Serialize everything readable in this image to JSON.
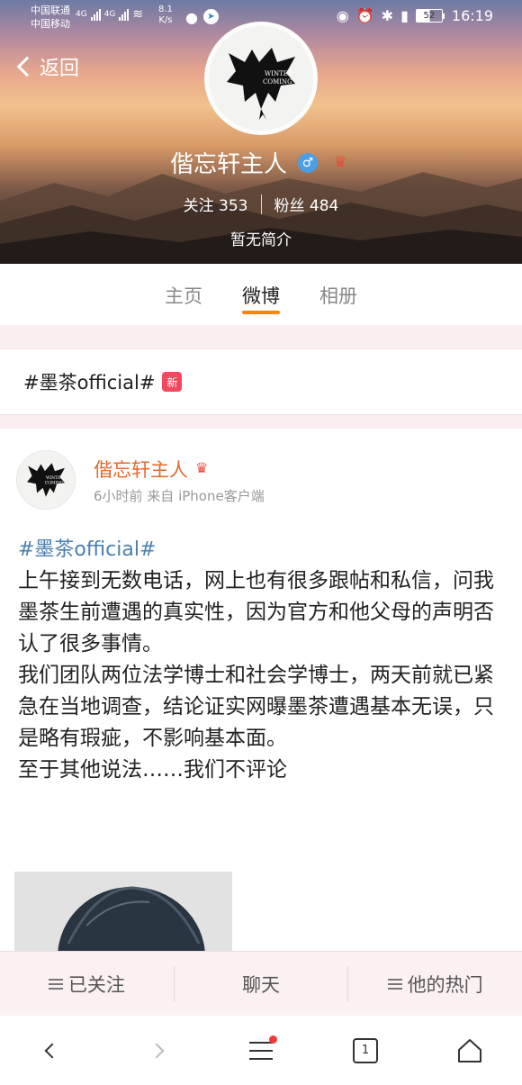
{
  "status_bar": {
    "carrier1": "中国联通",
    "carrier2": "中国移动",
    "net1": "4G",
    "net2": "4G",
    "speed_value": "8.1",
    "speed_unit": "K/s",
    "battery": "52",
    "time": "16:19"
  },
  "header": {
    "back_label": "返回",
    "name": "偕忘轩主人",
    "gender_symbol": "♂",
    "following_label": "关注",
    "following_count": "353",
    "followers_label": "粉丝",
    "followers_count": "484",
    "bio": "暂无简介",
    "avatar_text_1": "WINTER",
    "avatar_text_2": "COMING"
  },
  "tabs": [
    {
      "label": "主页",
      "active": false
    },
    {
      "label": "微博",
      "active": true
    },
    {
      "label": "相册",
      "active": false
    }
  ],
  "topic_row": {
    "label": "#墨茶official#",
    "badge": "新"
  },
  "post": {
    "author": "偕忘轩主人",
    "meta": "6小时前  来自 iPhone客户端",
    "topic": "#墨茶official#",
    "paragraphs": [
      "上午接到无数电话，网上也有很多跟帖和私信，问我墨茶生前遭遇的真实性，因为官方和他父母的声明否认了很多事情。",
      "我们团队两位法学博士和社会学博士，两天前就已紧急在当地调查，结论证实网曝墨茶遭遇基本无误，只是略有瑕疵，不影响基本面。",
      "至于其他说法……我们不评论"
    ]
  },
  "action_bar": {
    "follow": "已关注",
    "chat": "聊天",
    "hot": "他的热门"
  },
  "browser_bar": {
    "tab_count": "1"
  },
  "colors": {
    "accent": "#ff8200",
    "author_name": "#e8682a",
    "topic_link": "#4a7fb0"
  }
}
